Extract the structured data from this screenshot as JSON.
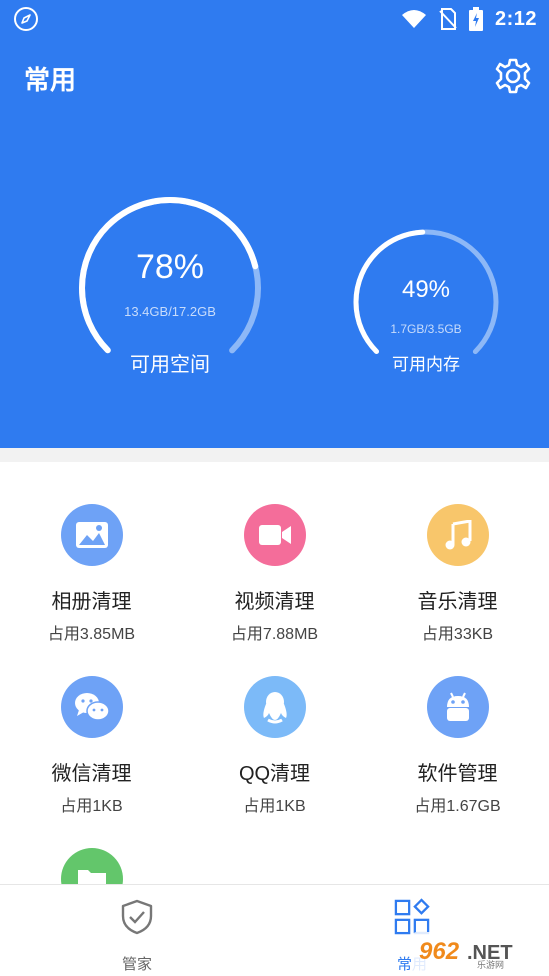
{
  "status_bar": {
    "time": "2:12",
    "icons": [
      "rocket-icon",
      "wifi-icon",
      "no-sim-icon",
      "battery-charging-icon"
    ]
  },
  "header": {
    "title": "常用",
    "settings_icon": "gear-icon"
  },
  "storage": {
    "percent_text": "78%",
    "percent": 78,
    "detail": "13.4GB/17.2GB",
    "label": "可用空间"
  },
  "memory": {
    "percent_text": "49%",
    "percent": 49,
    "detail": "1.7GB/3.5GB",
    "label": "可用内存"
  },
  "tools": [
    {
      "name": "相册清理",
      "size": "占用3.85MB",
      "icon": "photo-icon",
      "color": "#6ea2f6"
    },
    {
      "name": "视频清理",
      "size": "占用7.88MB",
      "icon": "video-camera-icon",
      "color": "#f46d9a"
    },
    {
      "name": "音乐清理",
      "size": "占用33KB",
      "icon": "music-note-icon",
      "color": "#f8c66b"
    },
    {
      "name": "微信清理",
      "size": "占用1KB",
      "icon": "wechat-icon",
      "color": "#6ea2f6"
    },
    {
      "name": "QQ清理",
      "size": "占用1KB",
      "icon": "qq-penguin-icon",
      "color": "#7cbaf8"
    },
    {
      "name": "软件管理",
      "size": "占用1.67GB",
      "icon": "android-icon",
      "color": "#6ea2f6"
    },
    {
      "name": "",
      "size": "",
      "icon": "folder-icon",
      "color": "#63c66b"
    }
  ],
  "nav": {
    "items": [
      {
        "label": "管家",
        "icon": "shield-check-icon",
        "color": "#666666"
      },
      {
        "label": "常用",
        "icon": "apps-grid-icon",
        "color": "#2f7bf0"
      }
    ]
  },
  "watermark": {
    "text": "962.NET",
    "subtext": "乐游网"
  },
  "colors": {
    "primary": "#2f7bf0",
    "gauge_track": "#8db8f7",
    "gauge_fill": "#ffffff"
  }
}
